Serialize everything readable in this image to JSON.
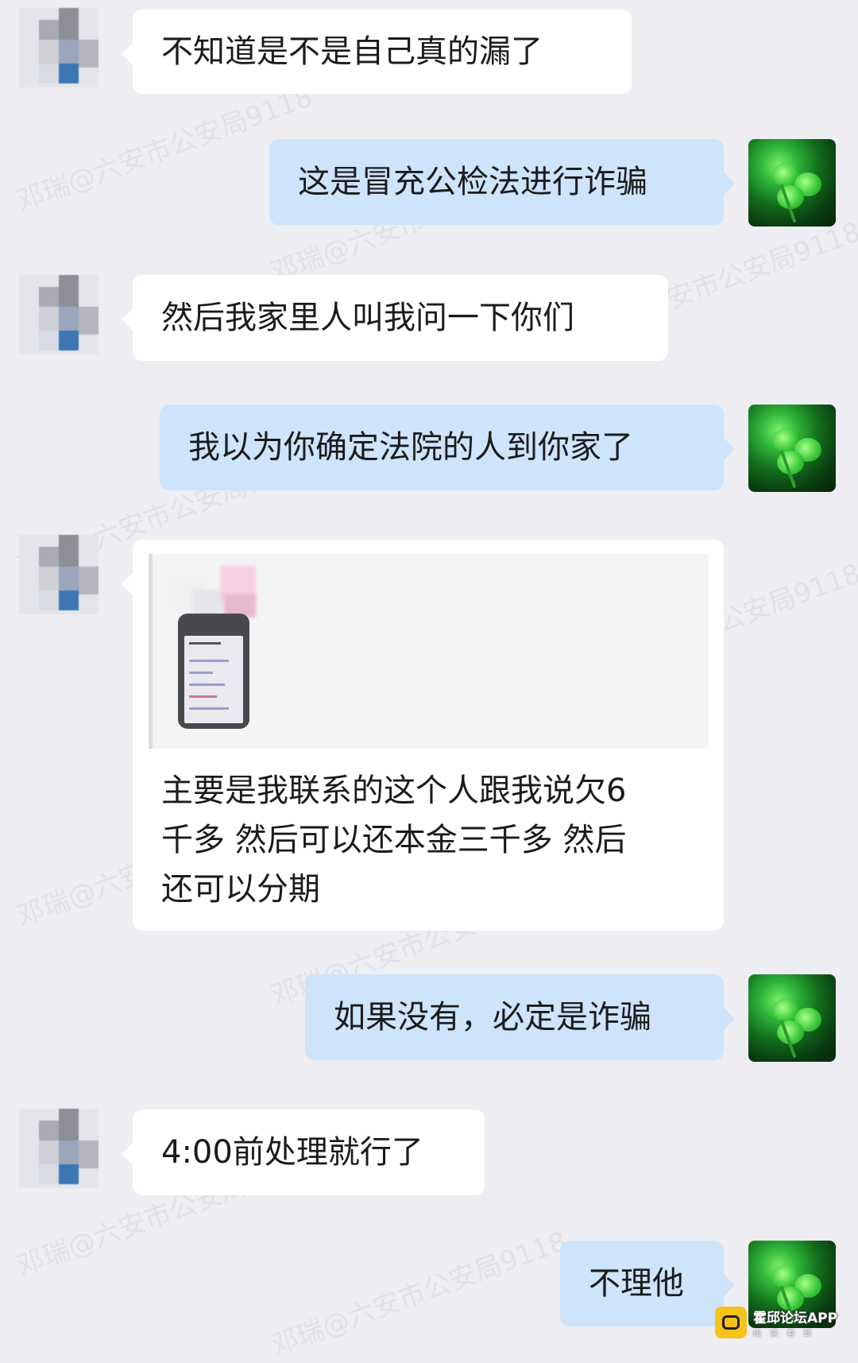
{
  "messages": [
    {
      "side": "left",
      "text": "不知道是不是自己真的漏了"
    },
    {
      "side": "right",
      "text": "这是冒充公检法进行诈骗"
    },
    {
      "side": "left",
      "text": "然后我家里人叫我问一下你们"
    },
    {
      "side": "right",
      "text": "我以为你确定法院的人到你家了"
    },
    {
      "side": "left",
      "quoted_image": "blurred-phone-screenshot",
      "text": "主要是我联系的这个人跟我说欠6\n千多 然后可以还本金三千多 然后\n还可以分期"
    },
    {
      "side": "right",
      "text": "如果没有，必定是诈骗"
    },
    {
      "side": "left",
      "text": "4:00前处理就行了"
    },
    {
      "side": "right",
      "text": "不理他"
    }
  ],
  "watermark": {
    "text": "邓瑞@六安市公安局9118"
  },
  "app_badge": {
    "name": "霍邱论坛APP",
    "sub": "阅 读 看 邱"
  },
  "colors": {
    "background": "#ededf2",
    "left_bubble": "#ffffff",
    "right_bubble": "#cde4fb"
  }
}
